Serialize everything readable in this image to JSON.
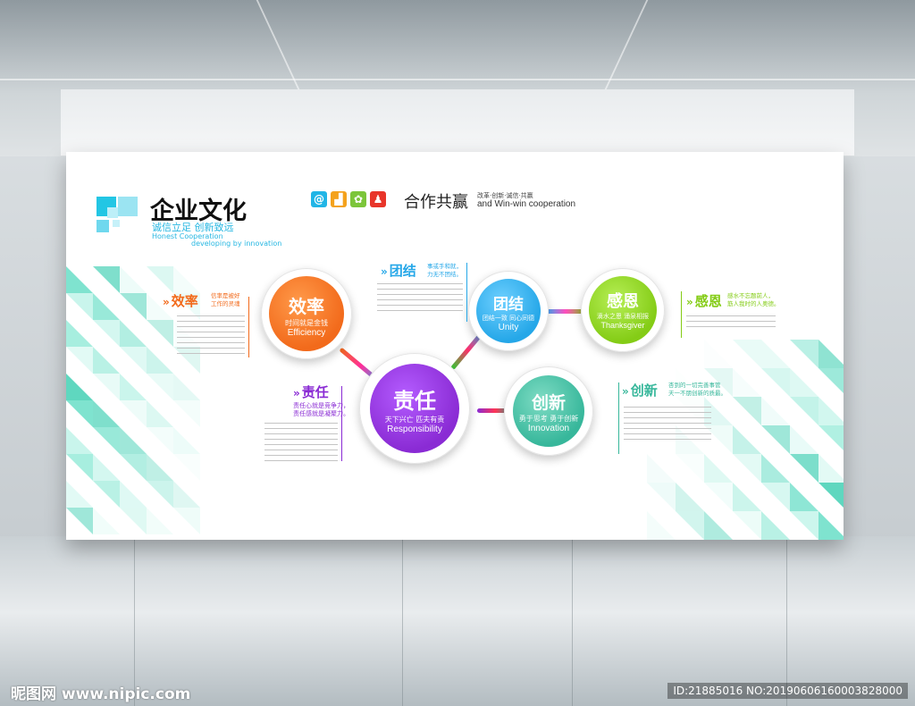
{
  "header": {
    "title": "企业文化",
    "slogan": "诚信立足 创新致远",
    "slogan_en_1": "Honest Cooperation",
    "slogan_en_2": "developing by innovation",
    "coop_cn": "合作共赢",
    "coop_small": "改革·创新·诚信·共赢",
    "coop_en": "and Win-win  cooperation",
    "icon_names": [
      "at-icon",
      "chart-icon",
      "flower-icon",
      "person-icon"
    ]
  },
  "nodes": {
    "efficiency": {
      "cn": "效率",
      "small": "时间就是金钱",
      "en": "Efficiency",
      "color": "#f26a1b"
    },
    "responsibility": {
      "cn": "责任",
      "small": "天下兴亡  匹夫有责",
      "en": "Responsibility",
      "color": "#8a2bd4"
    },
    "unity": {
      "cn": "团结",
      "small": "团结一致  同心同德",
      "en": "Unity",
      "color": "#25a7e8"
    },
    "innovation": {
      "cn": "创新",
      "small": "勇于思考  勇于创新",
      "en": "Innovation",
      "color": "#37b79b"
    },
    "thanks": {
      "cn": "感恩",
      "small": "滴水之恩  涌泉相报",
      "en": "Thanksgiver",
      "color": "#84cc16"
    }
  },
  "sections": {
    "efficiency": {
      "head": "效率",
      "tag1": "信率是被好",
      "tag2": "工作的灵魂",
      "color": "#f26a1b"
    },
    "unity": {
      "head": "团结",
      "tag1": "事或手和就，",
      "tag2": "力无不团结。",
      "color": "#25a7e8"
    },
    "responsibility": {
      "head": "责任",
      "tag1": "责任心就是竞争力，",
      "tag2": "责任感就是凝聚力。",
      "color": "#8a2bd4"
    },
    "thanks": {
      "head": "感恩",
      "tag1": "感水不忘题前人，",
      "tag2": "筋人我时的人奥德。",
      "color": "#84cc16"
    },
    "innovation": {
      "head": "创新",
      "tag1": "杏到的一切完善事管",
      "tag2": "天一不朋创新的质最。",
      "color": "#37b79b"
    }
  },
  "watermark": {
    "left": "昵图网 www.nipic.com",
    "right": "ID:21885016 NO:20190606160003828000"
  }
}
